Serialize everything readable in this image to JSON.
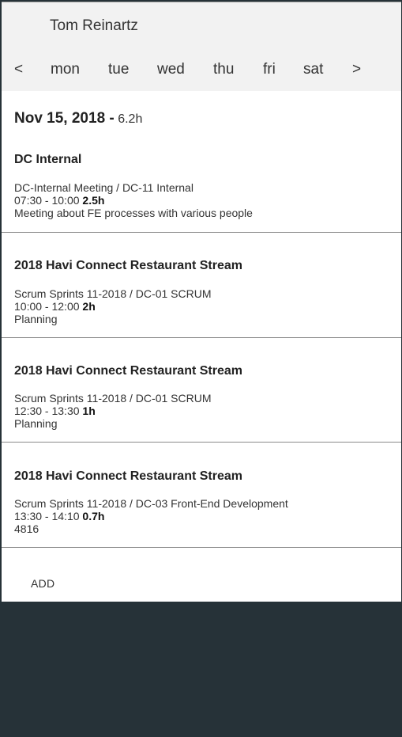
{
  "header": {
    "user_name": "Tom Reinartz"
  },
  "week_nav": {
    "prev": "<",
    "next": ">",
    "days": [
      "mon",
      "tue",
      "wed",
      "thu",
      "fri",
      "sat"
    ]
  },
  "day": {
    "date": "Nov 15, 2018 -",
    "total": "6.2h"
  },
  "entries": [
    {
      "title": "DC Internal",
      "task": "DC-Internal Meeting / DC-11 Internal",
      "time": "07:30 - 10:00",
      "duration": "2.5h",
      "note": "Meeting about FE processes with various people"
    },
    {
      "title": "2018 Havi Connect Restaurant Stream",
      "task": "Scrum Sprints 11-2018 / DC-01 SCRUM",
      "time": "10:00 - 12:00",
      "duration": "2h",
      "note": "Planning"
    },
    {
      "title": "2018 Havi Connect Restaurant Stream",
      "task": "Scrum Sprints 11-2018 / DC-01 SCRUM",
      "time": "12:30 - 13:30",
      "duration": "1h",
      "note": "Planning"
    },
    {
      "title": "2018 Havi Connect Restaurant Stream",
      "task": "Scrum Sprints 11-2018 / DC-03 Front-End Development",
      "time": "13:30 - 14:10",
      "duration": "0.7h",
      "note": "4816"
    }
  ],
  "actions": {
    "add_label": "ADD"
  },
  "colors": {
    "header_bg": "#f2f2f2",
    "page_bg": "#263238",
    "card_bg": "#ffffff"
  }
}
